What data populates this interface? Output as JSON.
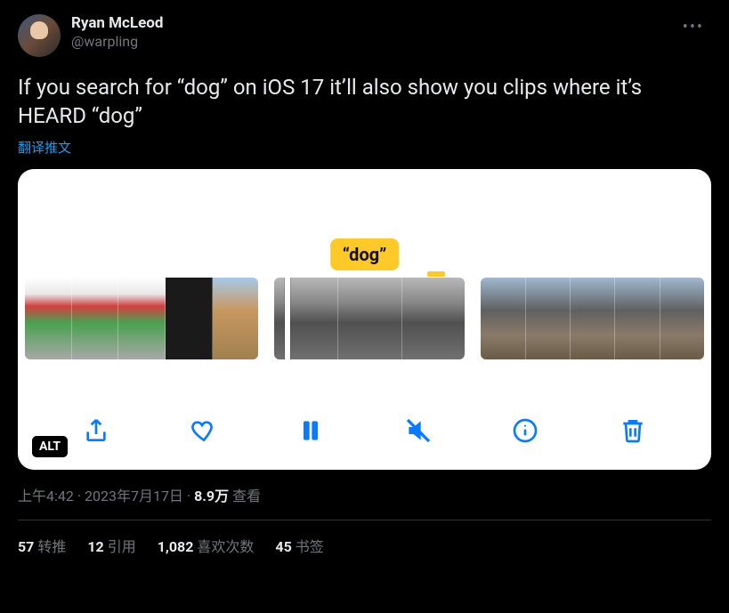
{
  "author": {
    "name": "Ryan McLeod",
    "handle": "@warpling"
  },
  "tweet_text": "If you search for “dog” on iOS 17 it’ll also show you clips where it’s HEARD “dog”",
  "translate_label": "翻译推文",
  "media": {
    "tooltip": "“dog”",
    "alt_badge": "ALT"
  },
  "meta": {
    "time": "上午4:42",
    "date": "2023年7月17日",
    "views_number": "8.9万",
    "views_label": "查看",
    "separator": " · "
  },
  "stats": {
    "retweets": {
      "count": "57",
      "label": "转推"
    },
    "quotes": {
      "count": "12",
      "label": "引用"
    },
    "likes": {
      "count": "1,082",
      "label": "喜欢次数"
    },
    "bookmarks": {
      "count": "45",
      "label": "书签"
    }
  },
  "icons": {
    "more": "more-icon",
    "share": "share-icon",
    "heart": "heart-icon",
    "pause": "pause-icon",
    "mute": "mute-icon",
    "info": "info-icon",
    "trash": "trash-icon"
  }
}
